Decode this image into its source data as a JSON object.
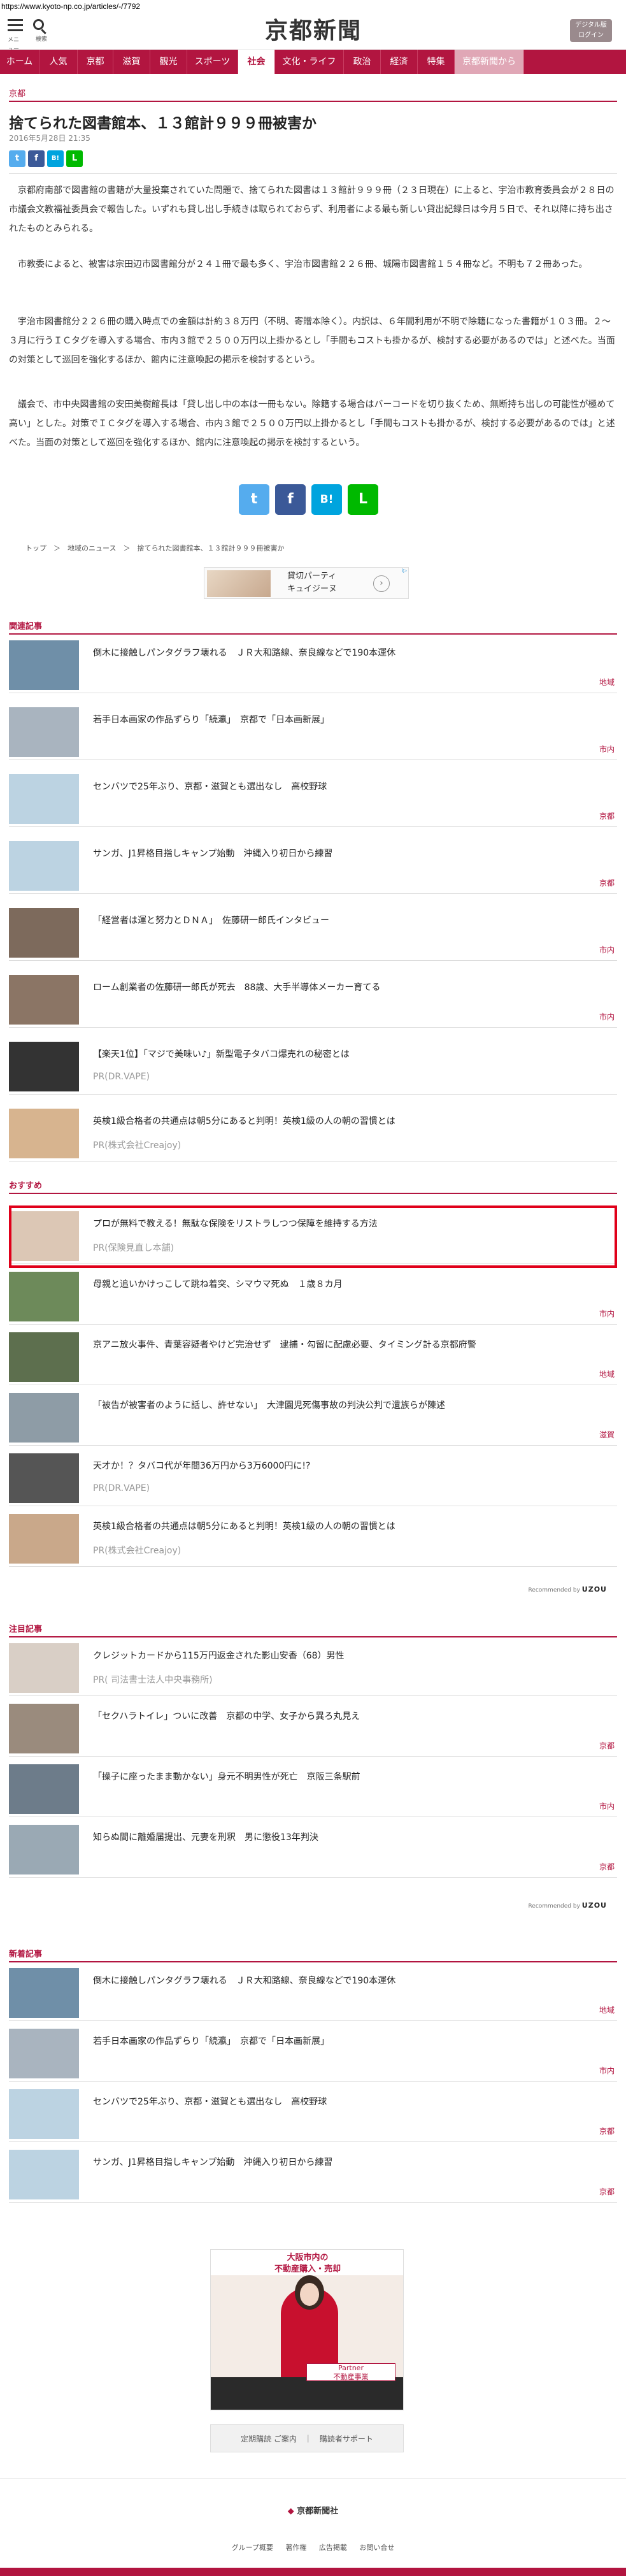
{
  "url": "https://www.kyoto-np.co.jp/articles/-/7792",
  "header": {
    "menu_label": "メニュー",
    "search_label": "検索",
    "logo": "京都新聞",
    "digital_btn": "デジタル版\nログイン"
  },
  "nav": [
    "ホーム",
    "人気",
    "京都",
    "滋賀",
    "観光",
    "スポーツ",
    "社会",
    "文化・ライフ",
    "政治",
    "経済",
    "特集",
    "京都新聞から"
  ],
  "article": {
    "section": "京都",
    "title": "捨てられた図書館本、１３館計９９９冊被害か",
    "date": "2016年5月28日 21:35",
    "p1": "京都府南部で図書館の書籍が大量投棄されていた問題で、捨てられた図書は１３館計９９９冊（２３日現在）に上ると、宇治市教育委員会が２８日の市議会文教福祉委員会で報告した。いずれも貸し出し手続きは取られておらず、利用者による最も新しい貸出記録日は今月５日で、それ以降に持ち出されたものとみられる。",
    "p2": "市教委によると、被害は宗田辺市図書館分が２４１冊で最も多く、宇治市図書館２２６冊、城陽市図書館１５４冊など。不明も７２冊あった。",
    "p3": "宇治市図書館分２２６冊の購入時点での金額は計約３８万円（不明、寄贈本除く）。内訳は、６年間利用が不明で除籍になった書籍が１０３冊。２～３月に行うＩＣタグを導入する場合、市内３館で２５００万円以上掛かるとし「手間もコストも掛かるが、検討する必要があるのでは」と述べた。当面の対策として巡回を強化するほか、館内に注意喚起の掲示を検討するという。",
    "p4": "議会で、市中央図書館の安田美樹館長は「貸し出し中の本は一冊もない。除籍する場合はバーコードを切り抜くため、無断持ち出しの可能性が極めて高い」とした。対策でＩＣタグを導入する場合、市内３館で２５００万円以上掛かるとし「手間もコストも掛かるが、検討する必要があるのでは」と述べた。当面の対策として巡回を強化するほか、館内に注意喚起の掲示を検討するという。",
    "share_small": [
      "t",
      "f",
      "B!",
      "L"
    ],
    "share_big": [
      "t",
      "f",
      "B!",
      "L"
    ]
  },
  "breadcrumb": "トップ　＞　地域のニュース　＞　捨てられた図書館本、１３館計９９９冊被害か",
  "ad_top": {
    "text": "貸切パーティ\nキュイジーヌ",
    "arrow": "›",
    "tag": "i▷"
  },
  "related": {
    "heading": "関連記事",
    "items": [
      {
        "title": "倒木に接触しパンタグラフ壊れる　ＪＲ大和路線、奈良線などで190本運休",
        "cat": "地域",
        "pr": ""
      },
      {
        "title": "若手日本画家の作品ずらり「続瀛」　京都で「日本画新展」",
        "cat": "市内",
        "pr": ""
      },
      {
        "title": "センバツで25年ぶり、京都・滋賀とも選出なし　高校野球",
        "cat": "京都",
        "pr": ""
      },
      {
        "title": "サンガ、J1昇格目指しキャンプ始動　沖縄入り初日から練習",
        "cat": "京都",
        "pr": ""
      },
      {
        "title": "「経営者は運と努力とＤＮＡ」　佐藤研一郎氏インタビュー",
        "cat": "市内",
        "pr": ""
      },
      {
        "title": "ローム創業者の佐藤研一郎氏が死去　88歳、大手半導体メーカー育てる",
        "cat": "市内",
        "pr": ""
      },
      {
        "title": "【楽天1位】「マジで美味い♪」新型電子タバコ爆売れの秘密とは",
        "cat": "",
        "pr": "PR(DR.VAPE)"
      },
      {
        "title": "英検1級合格者の共通点は朝5分にあると判明！英検1級の人の朝の習慣とは",
        "cat": "",
        "pr": "PR(株式会社Creajoy)"
      }
    ]
  },
  "recommend": {
    "heading": "おすすめ",
    "items": [
      {
        "title": "プロが無料で教える！無駄な保険をリストラしつつ保障を維持する方法",
        "cat": "",
        "pr": "PR(保険見直し本舗)"
      },
      {
        "title": "母親と追いかけっこして跳ね着突、シマウマ死ぬ　１歳８カ月",
        "cat": "市内",
        "pr": ""
      },
      {
        "title": "京アニ放火事件、青葉容疑者やけど完治せず　逮捕・勾留に配慮必要、タイミング計る京都府警",
        "cat": "地域",
        "pr": ""
      },
      {
        "title": "「被告が被害者のように話し、許せない」　大津園児死傷事故の判決公判で遺族らが陳述",
        "cat": "滋賀",
        "pr": ""
      },
      {
        "title": "天才か！？タバコ代が年間36万円から3万6000円に!?",
        "cat": "",
        "pr": "PR(DR.VAPE)"
      },
      {
        "title": "英検1級合格者の共通点は朝5分にあると判明！英検1級の人の朝の習慣とは",
        "cat": "",
        "pr": "PR(株式会社Creajoy)"
      }
    ],
    "recommended_by": "Recommended by",
    "brand": "UZOU"
  },
  "featured": {
    "heading": "注目記事",
    "items": [
      {
        "title": "クレジットカードから115万円返金された影山安香（68）男性",
        "cat": "",
        "pr": "PR( 司法書士法人中央事務所)"
      },
      {
        "title": "「セクハラトイレ」ついに改善　京都の中学、女子から異ろ丸見え",
        "cat": "京都",
        "pr": ""
      },
      {
        "title": "「操子に座ったまま動かない」身元不明男性が死亡　京阪三条駅前",
        "cat": "市内",
        "pr": ""
      },
      {
        "title": "知らぬ間に離婚届提出、元妻を刑釈　男に懲役13年判決",
        "cat": "京都",
        "pr": ""
      }
    ],
    "recommended_by": "Recommended by",
    "brand": "UZOU"
  },
  "latest": {
    "heading": "新着記事",
    "items": [
      {
        "title": "倒木に接触しパンタグラフ壊れる　ＪＲ大和路線、奈良線などで190本運休",
        "cat": "地域",
        "pr": ""
      },
      {
        "title": "若手日本画家の作品ずらり「続瀛」　京都で「日本画新展」",
        "cat": "市内",
        "pr": ""
      },
      {
        "title": "センバツで25年ぶり、京都・滋賀とも選出なし　高校野球",
        "cat": "京都",
        "pr": ""
      },
      {
        "title": "サンガ、J1昇格目指しキャンプ始動　沖縄入り初日から練習",
        "cat": "京都",
        "pr": ""
      }
    ]
  },
  "big_ad": {
    "top": "大阪市内の\n不動産購入・売却",
    "banner": "Partner\n不動産事業"
  },
  "subscribe": "定期購読 ご案内　｜　購読者サポート",
  "footer": {
    "logo": "京都新聞社",
    "links": [
      "グループ概要",
      "著作権",
      "広告掲載",
      "お問い合せ"
    ]
  },
  "colors": {
    "brand": "#b21540",
    "highlight": "#e0001a",
    "twitter": "#55acee",
    "facebook": "#3b5998",
    "hatena": "#00a4de",
    "line": "#00b900"
  }
}
